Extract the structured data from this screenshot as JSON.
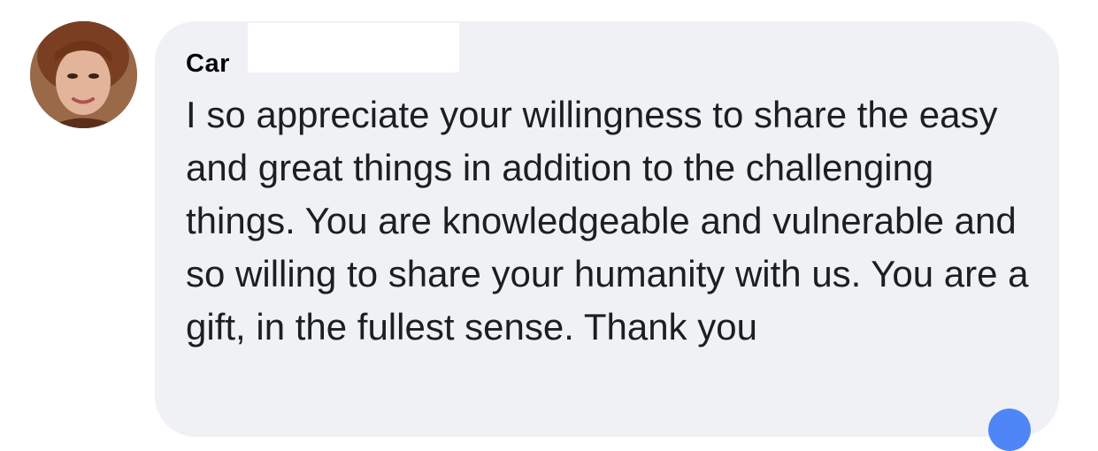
{
  "comment": {
    "author_visible": "Car",
    "text": "I so appreciate your willingness to share the easy and great things in addition to the challenging things. You are knowledgeable and vulnerable and so willing to share your humanity with us. You are a gift, in the fullest sense. Thank you"
  },
  "colors": {
    "bubble": "#f0f1f4",
    "text": "#1c1e21",
    "reaction": "#4f86f7"
  },
  "icons": {
    "avatar": "profile-photo",
    "reaction": "reaction-icon"
  }
}
